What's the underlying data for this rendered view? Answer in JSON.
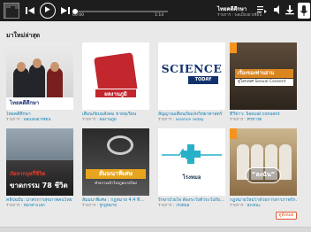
{
  "player": {
    "time_current": "00:00",
    "time_total": "1:14",
    "title": "ไทยคดีศึกษา",
    "meta_label": "รายการ :",
    "meta_value": "พลเมืองอาเซียน"
  },
  "section": {
    "title": "มาใหม่ล่าสุด"
  },
  "cards": [
    {
      "title": "ไทยคดีศึกษา",
      "label": "รายการ :",
      "value": "พลเมืองอาเซียน",
      "thumb_text": "ไทยคดีศึกษา"
    },
    {
      "title": "เตือนภัยบนสังคม ขายทุเรียน",
      "label": "รายการ :",
      "value": "ผลงานภูมิ",
      "thumb_text": "ผลงานภูมิ"
    },
    {
      "title": "สัญญาณเตือนภัยแห่งวิทยาศาสตร์",
      "label": "รายการ :",
      "value": "Science Today",
      "thumb_text_1": "SCIENCE",
      "thumb_text_2": "TODAY"
    },
    {
      "title": "ทีวีข่าว: Sexual consent",
      "label": "รายการ :",
      "value": "ทีวีข่าวดี",
      "thumb_text_1": "เรื่องของท่านอ่าน",
      "thumb_text_2": "สู่โลกเพศ Sexual Consent"
    },
    {
      "title": "คลิปฉบับ: มาตรการสุขภาพคนไทย",
      "label": "รายการ :",
      "value": "หน้าต่างโลก",
      "thumb_text_1": "ภัยจากบุหรี่ชีวิต",
      "thumb_text_2": "ขาดกรรม 78 ชีวิต"
    },
    {
      "title": "สัมมนาพิเศษ : กฎหมาย 4.4 ที่...",
      "label": "รายการ :",
      "value": "รู้กฎหมาย",
      "thumb_text_1": "สัมมนาพิเศษ",
      "thumb_text_2": "ทำความเข้าใจกฎหมายใหม่"
    },
    {
      "title": "รักษาป่วยใจ ต้องระวังตัวระวังภัย...",
      "label": "รายการ :",
      "value": "โรงหมอ",
      "thumb_text": "โรงหมอ"
    },
    {
      "title": "กฎหมายใหม่ว่าด้วยการสารภาพรัก...",
      "label": "รายการ :",
      "value": "ลงใจนะ",
      "thumb_text": "“ลงฉัน”"
    }
  ],
  "more_label": "ดูทั้งหมด",
  "colors": {
    "link": "#0d7db3",
    "accent": "#e1552d",
    "player_bg": "#1d1d1d"
  },
  "icons": [
    "previous-icon",
    "play-icon",
    "next-icon",
    "playlist-icon",
    "volume-icon",
    "download-icon",
    "microphone-icon"
  ]
}
